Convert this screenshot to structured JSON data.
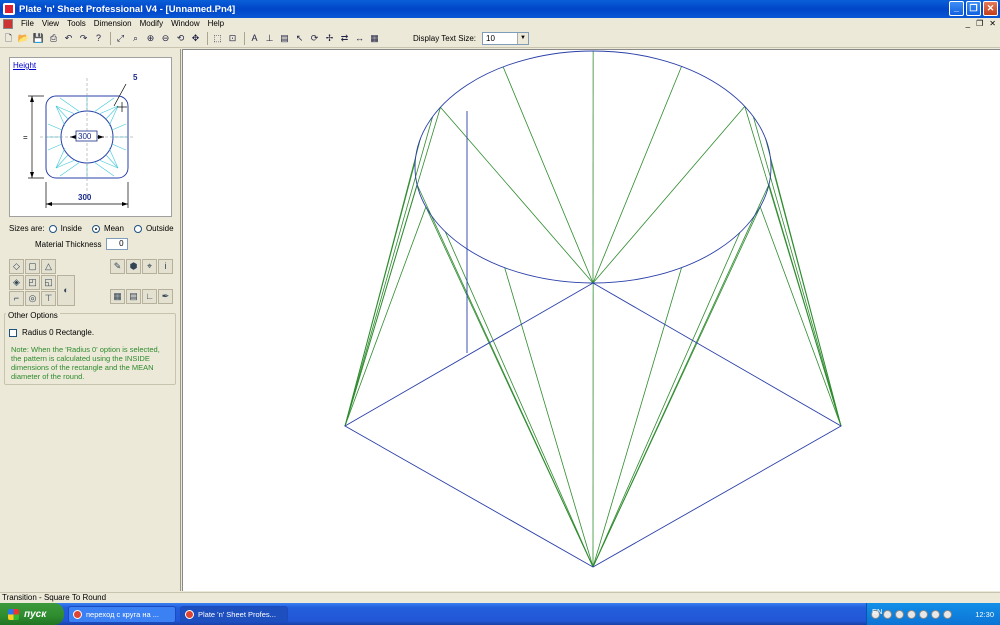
{
  "window": {
    "title": "Plate 'n' Sheet Professional V4 - [Unnamed.Pn4]",
    "buttons": {
      "minimize": "_",
      "maximize": "❐",
      "close": "✕"
    }
  },
  "menu": {
    "items": [
      "File",
      "View",
      "Tools",
      "Dimension",
      "Modify",
      "Window",
      "Help"
    ],
    "mdi": {
      "minimize": "_",
      "restore": "❐",
      "close": "✕"
    }
  },
  "toolbar": {
    "display_text_size_label": "Display Text Size:",
    "display_text_size_value": "10",
    "dropdown_arrow": "▼"
  },
  "preview": {
    "height_link": "Height",
    "dim_corner": "5",
    "dim_diameter": "300",
    "dim_width": "300",
    "dim_height": "="
  },
  "sizes": {
    "label": "Sizes are:",
    "options": [
      "Inside",
      "Mean",
      "Outside"
    ],
    "selected": "Mean"
  },
  "material_thickness": {
    "label": "Material Thickness",
    "value": "0"
  },
  "other_options": {
    "title": "Other Options",
    "checkbox_label": "Radius 0 Rectangle.",
    "checked": false,
    "note": "Note:  When the 'Radius 0' option is selected, the pattern is calculated using the INSIDE dimensions of the rectangle and the MEAN diameter of the round."
  },
  "colors": {
    "outline": "#2A3FA8",
    "fold_lines": "#2E8B2E",
    "note_text": "#2E8B2E"
  },
  "status": {
    "text": "Transition - Square To Round"
  },
  "taskbar": {
    "start_label": "пуск",
    "tasks": [
      "переход с круга на ...",
      "Plate 'n' Sheet Profes..."
    ],
    "lang": "EN",
    "clock": "12:30"
  }
}
